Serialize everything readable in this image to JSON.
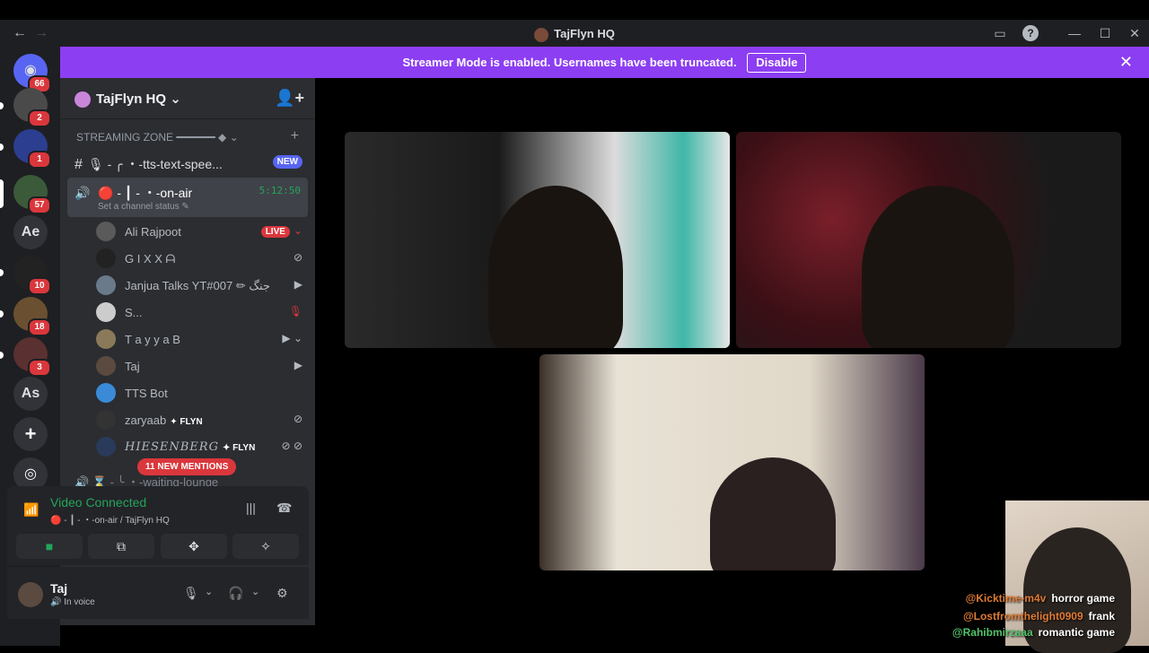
{
  "window": {
    "title": "TajFlyn HQ"
  },
  "banner": {
    "message": "Streamer Mode is enabled. Usernames have been truncated.",
    "disable_label": "Disable"
  },
  "guilds": [
    {
      "icon": "discord-home-icon",
      "badge": "66"
    },
    {
      "icon": "server-avatar",
      "badge": "2"
    },
    {
      "icon": "server-avatar",
      "badge": "1"
    },
    {
      "icon": "server-avatar",
      "badge": "57"
    },
    {
      "icon": "server-text",
      "text": "Ae"
    },
    {
      "icon": "server-avatar",
      "badge": "10"
    },
    {
      "icon": "server-avatar",
      "badge": "18"
    },
    {
      "icon": "server-avatar",
      "badge": "3"
    },
    {
      "icon": "server-text",
      "text": "As"
    }
  ],
  "server": {
    "name": "TajFlyn HQ"
  },
  "category": {
    "name": "STREAMING ZONE ━━━━━━ ◆"
  },
  "channels": {
    "tts": {
      "name": "🎙 - ╭ ・-tts-text-spee...",
      "badge": "NEW"
    },
    "onair": {
      "name": "🔴 - ┃ - ・-on-air",
      "timer": "5:12:50",
      "status": "Set a channel status ✎"
    },
    "waiting": {
      "name": "⌛ - ╰ ・-waiting-lounge"
    }
  },
  "voice_users": [
    {
      "name": "Ali Rajpoot",
      "live": "LIVE",
      "right": "⌄"
    },
    {
      "name": "G I X X ᗩ",
      "right": "⊘"
    },
    {
      "name": "Janjua Talks YT#007 ✏ جنگ",
      "right": "▶"
    },
    {
      "name": "S...",
      "right": "🎙"
    },
    {
      "name": "T a y y a B",
      "right": "▶ ⌄"
    },
    {
      "name": "Taj",
      "right": "▶"
    },
    {
      "name": "TTS Bot",
      "right": ""
    },
    {
      "name": "zaryaab",
      "tag": "✦ FLYN",
      "right": "⊘"
    },
    {
      "name": "HIESENBERG",
      "tag": "✦ FLYN",
      "right": "⊘ ⊘"
    }
  ],
  "mentions": "11 NEW MENTIONS",
  "voice_panel": {
    "title": "Video Connected",
    "subtitle": "🔴 - ┃ - ・-on-air / TajFlyn HQ"
  },
  "user_panel": {
    "name": "Taj",
    "status": "In voice"
  },
  "chat": [
    {
      "user": "@Kicktime-m4v",
      "message": "horror game",
      "color": "#e07b33"
    },
    {
      "user": "@Lostfromthelight0909",
      "message": "frank",
      "color": "#e07b33"
    },
    {
      "user": "@Rahibmirzaaa",
      "message": "romantic game",
      "color": "#52c46a"
    }
  ],
  "colors": {
    "accent": "#8c3ef2",
    "green": "#23a55a",
    "red": "#da373c",
    "blurple": "#5865f2"
  }
}
